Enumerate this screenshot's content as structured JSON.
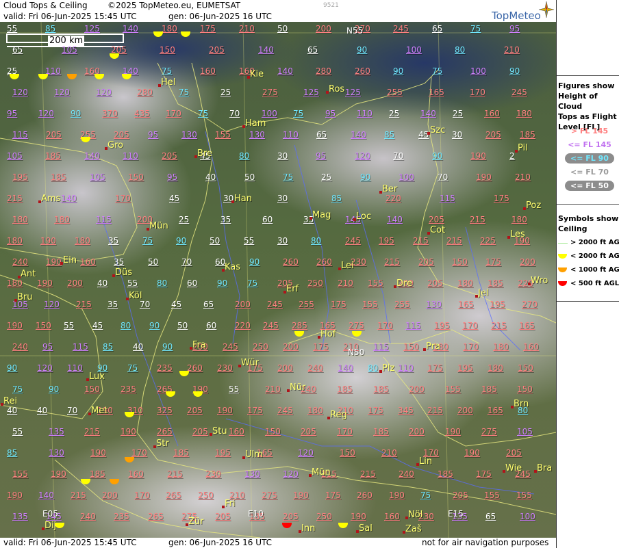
{
  "header": {
    "title": "Cloud Tops & Ceiling",
    "copyright": "©2025 TopMeteo.eu, EUMETSAT",
    "code": "9521",
    "valid": "valid:  Fri  06-Jun-2025  15:45 UTC",
    "gen": "gen: 06-Jun-2025 16 UTC",
    "brand": "TopMeteo"
  },
  "footer": {
    "valid": "valid:  Fri  06-Jun-2025  15:45 UTC",
    "gen": "gen: 06-Jun-2025 16 UTC",
    "note": "not for air navigation purposes"
  },
  "scale": "200 km",
  "colors": {
    "gt145": "#ff8080",
    "le145": "#d080ff",
    "le90": "#70e8ff",
    "le70": "#ffffff",
    "le50": "#ffffff"
  },
  "legend": {
    "tops_title": [
      "Figures show",
      "Height of Cloud",
      "Tops as Flight",
      "Level  [FL]"
    ],
    "tops": [
      {
        "label": "> FL 145",
        "color": "#ff8080",
        "bg": ""
      },
      {
        "label": "<= FL 145",
        "color": "#c070f0",
        "bg": ""
      },
      {
        "label": "<= FL 90",
        "color": "#70e8ff",
        "bg": "#8c8c8c"
      },
      {
        "label": "<= FL 70",
        "color": "#9a9a9a",
        "bg": ""
      },
      {
        "label": "<= FL 50",
        "color": "#ffffff",
        "bg": "#8c8c8c"
      }
    ],
    "ceil_title": [
      "Symbols show",
      "Ceiling"
    ],
    "ceil": [
      {
        "label": "> 2000 ft AGL",
        "color": "#a0e890"
      },
      {
        "label": "< 2000 ft AGL",
        "color": "#ffff00"
      },
      {
        "label": "< 1000 ft AGL",
        "color": "#ffa000"
      },
      {
        "label": "< 500 ft AGL",
        "color": "#ff0000"
      }
    ]
  },
  "grid_labels": [
    "N55",
    "N50",
    "E05",
    "E10",
    "E15"
  ],
  "cities": [
    "Kie",
    "Hel",
    "Ros",
    "Szc",
    "Ham",
    "Gro",
    "Bre",
    "Pil",
    "Ber",
    "Ams",
    "Han",
    "Mag",
    "Loc",
    "Poz",
    "Mün",
    "Cot",
    "Les",
    "Ein",
    "Ant",
    "Kas",
    "Lei",
    "Düs",
    "Wro",
    "Köl",
    "Bru",
    "Erf",
    "Dre",
    "Jel",
    "Hof",
    "Fra",
    "Pra",
    "Lux",
    "Wür",
    "Plz",
    "Rei",
    "Nür",
    "Met",
    "Reg",
    "Brn",
    "Stu",
    "Str",
    "Ulm",
    "Lin",
    "Wie",
    "Bra",
    "Mün",
    "Fri",
    "Inn",
    "Zür",
    "Sal",
    "Dij",
    "Zaš",
    "Nöl"
  ],
  "tops_values": {
    "row1": [
      "55",
      "85",
      "125",
      "140",
      "180",
      "175",
      "210",
      "50",
      "200",
      "270",
      "245",
      "65",
      "75",
      "95"
    ],
    "row2": [
      "65",
      "105",
      "205",
      "150",
      "205",
      "140",
      "65",
      "90",
      "100",
      "80",
      "210"
    ],
    "row3": [
      "25",
      "110",
      "160",
      "140",
      "75",
      "160",
      "160",
      "140",
      "280",
      "260",
      "90",
      "75",
      "100",
      "90"
    ],
    "row4": [
      "120",
      "120",
      "120",
      "280",
      "75",
      "25",
      "275",
      "125",
      "125",
      "255",
      "165",
      "170",
      "245"
    ],
    "row5": [
      "95",
      "120",
      "90",
      "370",
      "435",
      "170",
      "75",
      "70",
      "100",
      "75",
      "95",
      "110",
      "25",
      "140",
      "25",
      "160",
      "180"
    ],
    "row6": [
      "115",
      "205",
      "255",
      "205",
      "95",
      "130",
      "155",
      "130",
      "110",
      "65",
      "140",
      "85",
      "45",
      "30",
      "205",
      "185"
    ],
    "row7": [
      "105",
      "185",
      "140",
      "110",
      "205",
      "45",
      "80",
      "30",
      "95",
      "120",
      "70",
      "90",
      "190",
      "2"
    ],
    "row8": [
      "195",
      "185",
      "105",
      "150",
      "95",
      "40",
      "50",
      "75",
      "25",
      "90",
      "100",
      "70",
      "190",
      "210"
    ],
    "row9": [
      "215",
      "140",
      "170",
      "45",
      "30",
      "30",
      "85",
      "220",
      "115",
      "175"
    ],
    "row10": [
      "180",
      "180",
      "115",
      "200",
      "25",
      "35",
      "60",
      "35",
      "145",
      "140",
      "205",
      "215",
      "180"
    ],
    "row11": [
      "180",
      "190",
      "180",
      "35",
      "75",
      "90",
      "50",
      "55",
      "30",
      "80",
      "245",
      "195",
      "215",
      "215",
      "225",
      "190"
    ],
    "row12": [
      "240",
      "190",
      "160",
      "35",
      "50",
      "70",
      "60",
      "90",
      "260",
      "260",
      "230",
      "215",
      "205",
      "150",
      "175",
      "200"
    ],
    "row13": [
      "180",
      "190",
      "200",
      "40",
      "55",
      "80",
      "60",
      "90",
      "75",
      "205",
      "250",
      "210",
      "155",
      "200",
      "205",
      "180",
      "185",
      "220"
    ],
    "row14": [
      "105",
      "120",
      "215",
      "35",
      "70",
      "45",
      "65",
      "200",
      "245",
      "255",
      "175",
      "155",
      "255",
      "130",
      "165",
      "195",
      "270"
    ],
    "row15": [
      "190",
      "150",
      "55",
      "45",
      "80",
      "90",
      "50",
      "60",
      "220",
      "245",
      "285",
      "165",
      "275",
      "170",
      "115",
      "195",
      "170",
      "215",
      "165"
    ],
    "row16": [
      "240",
      "95",
      "115",
      "85",
      "40",
      "90",
      "200",
      "245",
      "250",
      "200",
      "175",
      "210",
      "115",
      "150",
      "180",
      "170",
      "180",
      "160"
    ],
    "row17": [
      "90",
      "120",
      "110",
      "90",
      "75",
      "235",
      "260",
      "230",
      "175",
      "200",
      "240",
      "140",
      "80",
      "110",
      "175",
      "195",
      "180",
      "150"
    ],
    "row18": [
      "75",
      "90",
      "150",
      "235",
      "265",
      "190",
      "55",
      "210",
      "240",
      "185",
      "185",
      "200",
      "155",
      "185",
      "150"
    ],
    "row19": [
      "40",
      "40",
      "70",
      "190",
      "310",
      "325",
      "205",
      "190",
      "175",
      "245",
      "180",
      "210",
      "175",
      "345",
      "215",
      "200",
      "165",
      "80"
    ],
    "row20": [
      "55",
      "135",
      "215",
      "190",
      "265",
      "205",
      "160",
      "150",
      "205",
      "170",
      "185",
      "200",
      "190",
      "275",
      "105"
    ],
    "row21": [
      "85",
      "130",
      "190",
      "170",
      "185",
      "195",
      "165",
      "120",
      "150",
      "210",
      "170",
      "190",
      "205"
    ],
    "row22": [
      "155",
      "190",
      "185",
      "160",
      "215",
      "230",
      "130",
      "120",
      "215",
      "215",
      "240",
      "185",
      "175",
      "245"
    ],
    "row23": [
      "190",
      "140",
      "215",
      "200",
      "170",
      "265",
      "250",
      "210",
      "275",
      "190",
      "175",
      "260",
      "190",
      "75",
      "205",
      "155",
      "155"
    ],
    "row24": [
      "135",
      "145",
      "240",
      "235",
      "265",
      "275",
      "205",
      "185",
      "205",
      "250",
      "190",
      "160",
      "230",
      "135",
      "65",
      "100"
    ]
  }
}
